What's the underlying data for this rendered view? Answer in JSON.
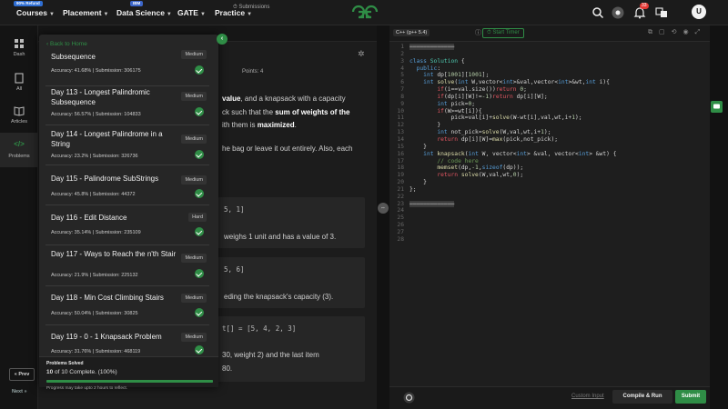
{
  "nav": {
    "refund_badge": "90% Refund",
    "courses": "Courses",
    "placement": "Placement",
    "ibm_badge": "IBM",
    "data_science": "Data Science",
    "gate": "GATE",
    "practice": "Practice",
    "notifications_count": "33",
    "avatar_letter": "U"
  },
  "rail": {
    "dash": "Dash",
    "all": "All",
    "articles": "Articles",
    "problems": "Problems",
    "prev": "« Prev",
    "next": "Next »"
  },
  "problem": {
    "tab_submissions": "Submissions",
    "points": "Points: 4",
    "text_line1_prefix": "value",
    "text_line1_suffix": ", and a knapsack with a capacity",
    "text_line2_prefix": "ck such that the ",
    "text_line2_bold": "sum of weights of the",
    "text_line3_prefix": "ith them is ",
    "text_line3_bold": "maximized",
    "text_line3_suffix": ".",
    "text_line4": "he bag or leave it out entirely. Also, each",
    "ex1_line1": "5, 1]",
    "ex1_line2": "weighs 1 unit and has a value of 3.",
    "ex2_line1": "5, 6]",
    "ex2_line2": "eding the knapsack's capacity (3).",
    "ex3_line1": "t[] = [5, 4, 2, 3]",
    "ex3_line2": "30, weight 2) and the last item",
    "ex3_line3": "80."
  },
  "panel": {
    "back_home": "Back to Home",
    "items": [
      {
        "title": "Subsequence",
        "diff": "Medium",
        "meta": "Accuracy: 41.68% | Submission: 306175"
      },
      {
        "title": "Day 113 - Longest Palindromic Subsequence",
        "diff": "Medium",
        "meta": "Accuracy: 56.57% | Submission: 104833"
      },
      {
        "title": "Day 114 - Longest Palindrome in a String",
        "diff": "Medium",
        "meta": "Accuracy: 23.2% | Submission: 326736"
      },
      {
        "title": "Day 115 - Palindrome SubStrings",
        "diff": "Medium",
        "meta": "Accuracy: 45.8% | Submission: 44372"
      },
      {
        "title": "Day 116 - Edit Distance",
        "diff": "Hard",
        "meta": "Accuracy: 35.14% | Submission: 235109"
      },
      {
        "title": "Day 117 - Ways to Reach the n'th Stair",
        "diff": "Medium",
        "meta": "Accuracy: 21.9% | Submission: 225132"
      },
      {
        "title": "Day 118 - Min Cost Climbing Stairs",
        "diff": "Medium",
        "meta": "Accuracy: 50.04% | Submission: 30825"
      },
      {
        "title": "Day 119 - 0 - 1 Knapsack Problem",
        "diff": "Medium",
        "meta": "Accuracy: 31.76% | Submission: 468119"
      }
    ],
    "progress_title": "Problems Solved",
    "progress_solved": "10",
    "progress_rest": " of 10 Complete. (100%)",
    "progress_fraction": 1.0,
    "progress_note": "Progress may take upto 2 hours to reflect."
  },
  "editor": {
    "language": "C++ (g++ 5.4)",
    "start_timer": "Start Timer",
    "custom_input": "Custom Input",
    "compile_run": "Compile & Run",
    "submit": "Submit",
    "line_numbers": [
      "1",
      "2",
      "3",
      "4",
      "5",
      "6",
      "7",
      "8",
      "9",
      "10",
      "11",
      "12",
      "13",
      "14",
      "15",
      "16",
      "17",
      "18",
      "19",
      "20",
      "21",
      "22",
      "23",
      "24",
      "25",
      "26",
      "27",
      "28"
    ]
  },
  "colors": {
    "accent": "#2f8d46",
    "background": "#1c1c1c",
    "badge_red": "#e53935"
  }
}
